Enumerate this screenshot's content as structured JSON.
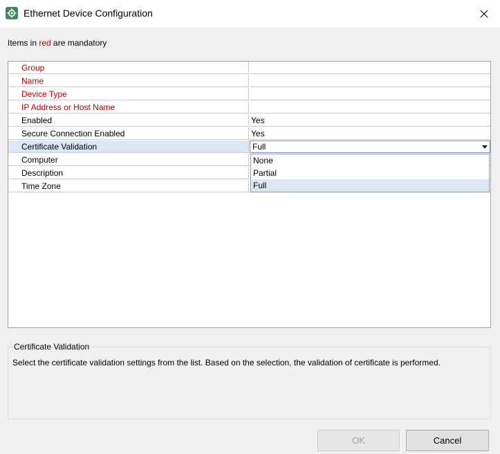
{
  "window": {
    "title": "Ethernet Device Configuration",
    "app_icon": "gear-icon",
    "close_icon": "close-icon"
  },
  "note": {
    "prefix": "Items in ",
    "red_word": "red",
    "suffix": " are mandatory"
  },
  "properties": {
    "rows": [
      {
        "label": "Group",
        "value": "",
        "mandatory": true
      },
      {
        "label": "Name",
        "value": "",
        "mandatory": true
      },
      {
        "label": "Device Type",
        "value": "",
        "mandatory": true
      },
      {
        "label": "IP Address or Host Name",
        "value": "",
        "mandatory": true
      },
      {
        "label": "Enabled",
        "value": "Yes",
        "mandatory": false
      },
      {
        "label": "Secure Connection Enabled",
        "value": "Yes",
        "mandatory": false
      },
      {
        "label": "Certificate Validation",
        "value": "Full",
        "mandatory": false
      },
      {
        "label": "Computer",
        "value": "",
        "mandatory": false
      },
      {
        "label": "Description",
        "value": "",
        "mandatory": false
      },
      {
        "label": "Time Zone",
        "value": "",
        "mandatory": false
      }
    ],
    "dropdown_options": [
      "None",
      "Partial",
      "Full"
    ],
    "selected_option": "Full"
  },
  "description": {
    "title": "Certificate Validation",
    "text": "Select the certificate validation settings from the list. Based on the selection, the validation of certificate is performed."
  },
  "buttons": {
    "ok": "OK",
    "cancel": "Cancel"
  },
  "colors": {
    "mandatory": "#c00000",
    "selection": "#dce6f5"
  }
}
